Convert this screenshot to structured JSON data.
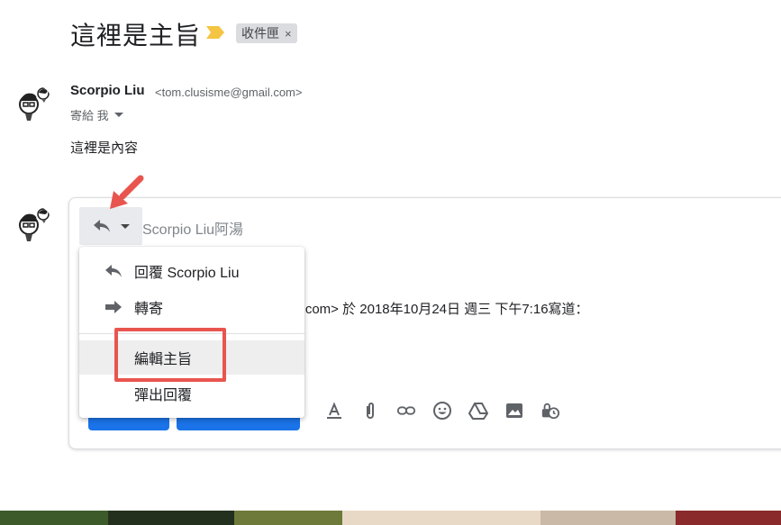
{
  "email": {
    "subject": "這裡是主旨",
    "label_chip": "收件匣",
    "label_remove": "×",
    "sender_name": "Scorpio Liu",
    "sender_email": "<tom.clusisme@gmail.com>",
    "to_line": "寄給 我",
    "body": "這裡是內容"
  },
  "reply": {
    "recipient": "Scorpio Liu阿湯",
    "quote_fragment": "il.com> 於 2018年10月24日 週三 下午7:16寫道："
  },
  "reply_menu": {
    "items": [
      {
        "label": "回覆 Scorpio Liu",
        "icon": "reply-icon"
      },
      {
        "label": "轉寄",
        "icon": "forward-icon"
      },
      {
        "label": "編輯主旨",
        "icon": ""
      },
      {
        "label": "彈出回覆",
        "icon": ""
      }
    ],
    "hovered_index": 2
  },
  "toolbar_icons": [
    "text-format-icon",
    "attach-icon",
    "link-icon",
    "emoji-icon",
    "drive-icon",
    "photo-icon",
    "confidential-icon"
  ],
  "colors": {
    "accent": "#1a73e8",
    "annotation": "#e8554e",
    "importance": "#f4c542"
  }
}
